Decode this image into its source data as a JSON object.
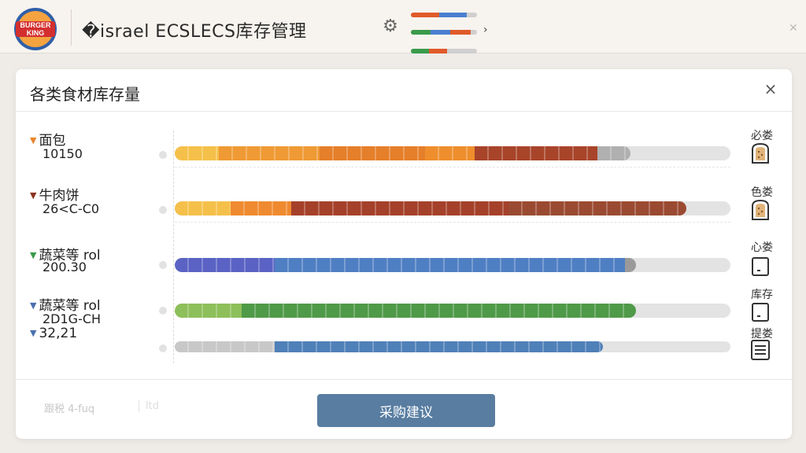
{
  "header": {
    "logo_text": "BURGER KING",
    "title": "�israel ECSLECS库存管理",
    "mini_bars": [
      {
        "fill": 0.85,
        "colors": [
          "#e05a2a",
          "#4a7fd0"
        ]
      },
      {
        "fill": 0.9,
        "colors": [
          "#3a9a4a",
          "#4a7fd0",
          "#e05a2a"
        ]
      },
      {
        "fill": 0.55,
        "colors": [
          "#3a9a4a",
          "#e05a2a"
        ]
      }
    ]
  },
  "panel": {
    "title": "各类食材库存量",
    "close_label": "×",
    "items": [
      {
        "name": "面包",
        "value": "10150",
        "marker_color": "#e8842c",
        "side_label": "必娄"
      },
      {
        "name": "牛肉饼",
        "value": "26<C-C0",
        "marker_color": "#8b3420",
        "side_label": "色娄"
      },
      {
        "name": "蔬菜等 rol",
        "value": "200.30",
        "marker_color": "#3a9a4a",
        "side_label": "心娄"
      },
      {
        "name": "蔬菜等 rol",
        "value": "2D1G-CH",
        "marker_color": "#4a6fb0",
        "side_label": "库存"
      },
      {
        "name": "32,21",
        "value": "",
        "marker_color": "#4a6fb0",
        "side_label": "提娄"
      }
    ],
    "bars": [
      {
        "fill": 0.82,
        "segments": [
          {
            "from": 0,
            "to": 0.08,
            "color": "#f5c04a"
          },
          {
            "from": 0.08,
            "to": 0.26,
            "color": "#ef9a34"
          },
          {
            "from": 0.26,
            "to": 0.45,
            "color": "#e57f2a"
          },
          {
            "from": 0.45,
            "to": 0.54,
            "color": "#ee8e2d"
          },
          {
            "from": 0.54,
            "to": 0.76,
            "color": "#a8442a"
          },
          {
            "from": 0.76,
            "to": 0.82,
            "color": "#b0b0b0"
          }
        ]
      },
      {
        "fill": 0.92,
        "segments": [
          {
            "from": 0,
            "to": 0.1,
            "color": "#f5c04a"
          },
          {
            "from": 0.1,
            "to": 0.21,
            "color": "#ef8a30"
          },
          {
            "from": 0.21,
            "to": 0.6,
            "color": "#a5412a"
          },
          {
            "from": 0.6,
            "to": 0.92,
            "color": "#9b4a32"
          }
        ]
      },
      {
        "fill": 0.83,
        "segments": [
          {
            "from": 0,
            "to": 0.18,
            "color": "#5a63c4"
          },
          {
            "from": 0.18,
            "to": 0.81,
            "color": "#4f7fc3"
          },
          {
            "from": 0.81,
            "to": 0.83,
            "color": "#9a9a9a"
          }
        ]
      },
      {
        "fill": 0.83,
        "segments": [
          {
            "from": 0,
            "to": 0.12,
            "color": "#8dbf5a"
          },
          {
            "from": 0.12,
            "to": 0.83,
            "color": "#4f9a48"
          }
        ]
      },
      {
        "fill": 0.77,
        "segments": [
          {
            "from": 0,
            "to": 0.18,
            "color": "#c8c8c8"
          },
          {
            "from": 0.18,
            "to": 0.77,
            "color": "#4f80b8"
          }
        ]
      }
    ]
  },
  "footer": {
    "hint_left": "跟税 4-fuq",
    "hint_right": "ltd",
    "purchase_button": "采购建议"
  },
  "colors": {
    "primary_button": "#587da1",
    "track": "#e3e3e3"
  }
}
